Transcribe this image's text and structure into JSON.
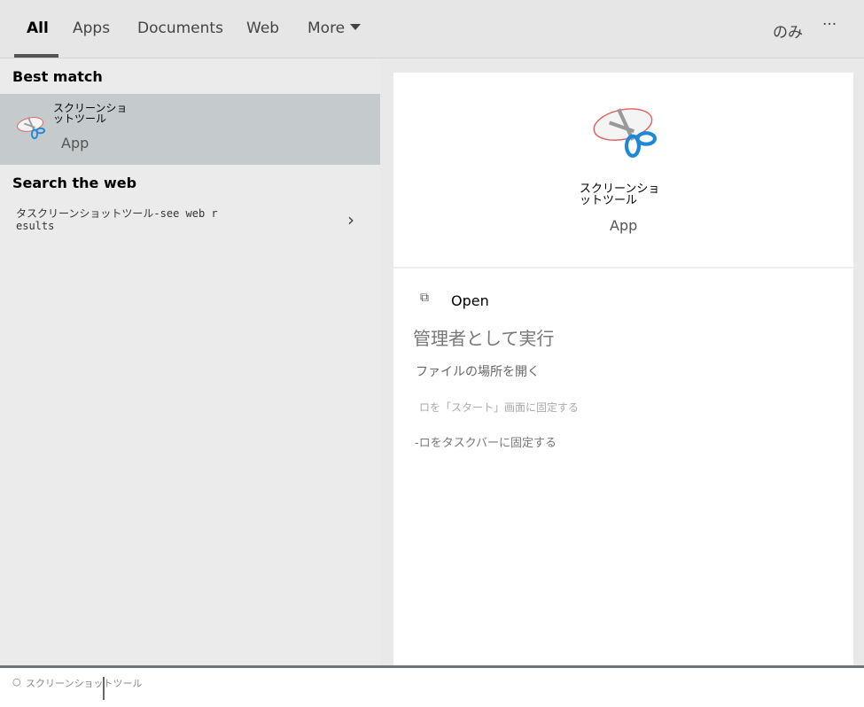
{
  "tabs": {
    "items": [
      {
        "label": "All"
      },
      {
        "label": "Apps"
      },
      {
        "label": "Documents"
      },
      {
        "label": "Web"
      },
      {
        "label": "More"
      }
    ],
    "account": "のみ",
    "more_options": "···"
  },
  "results": {
    "best_match_header": "Best match",
    "best_match": {
      "name_line1": "スクリーンショ",
      "name_line2": "ットツール",
      "type": "App",
      "icon": "snipping-tool-icon"
    },
    "web_header": "Search the web",
    "web_item": {
      "line1": "タスクリーンショットツール-see web r",
      "line2": "esults"
    }
  },
  "preview": {
    "name_line1": "スクリーンショ",
    "name_line2": "ットツール",
    "type": "App",
    "actions": [
      {
        "label": "Open",
        "icon": "open-icon"
      },
      {
        "label": "管理者として実行"
      },
      {
        "label": "ファイルの場所を開く"
      },
      {
        "label": "ロを「スタート」画面に固定する"
      },
      {
        "label": "-ロをタスクバーに固定する"
      }
    ]
  },
  "search": {
    "value": "スクリーンショットツール",
    "icon": "search-icon"
  },
  "colors": {
    "selected": "#c5cbcc",
    "scissors": "#1e88d8"
  }
}
